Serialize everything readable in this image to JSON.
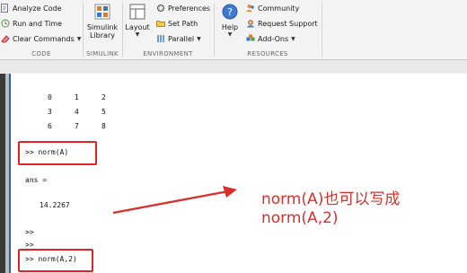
{
  "ribbon": {
    "code": {
      "label": "CODE",
      "analyze": "Analyze Code",
      "run_time": "Run and Time",
      "clear_commands": "Clear Commands"
    },
    "simulink": {
      "label": "SIMULINK",
      "library_line1": "Simulink",
      "library_line2": "Library"
    },
    "environment": {
      "label": "ENVIRONMENT",
      "layout": "Layout",
      "preferences": "Preferences",
      "set_path": "Set Path",
      "parallel": "Parallel"
    },
    "resources": {
      "label": "RESOURCES",
      "help": "Help",
      "community": "Community",
      "request_support": "Request Support",
      "addons": "Add-Ons"
    }
  },
  "console": {
    "matrix_rows": [
      [
        "0",
        "1",
        "2"
      ],
      [
        "3",
        "4",
        "5"
      ],
      [
        "6",
        "7",
        "8"
      ]
    ],
    "cmd1": ">> norm(A)",
    "ans_label": "ans =",
    "ans_value": "14.2267",
    "prompt1": ">>",
    "prompt2": ">>",
    "cmd2": ">> norm(A,2)"
  },
  "annotation": {
    "line1": "norm(A)也可以写成",
    "line2": "norm(A,2)",
    "color": "#d9302a"
  }
}
